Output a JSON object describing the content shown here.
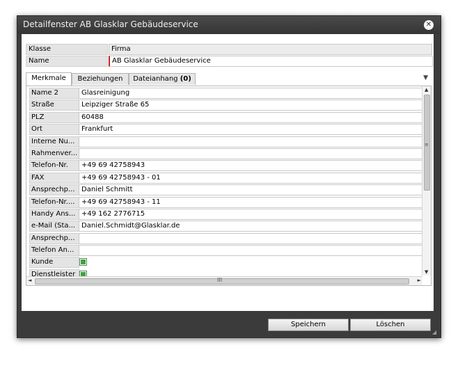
{
  "window": {
    "title": "Detailfenster AB Glasklar Gebäudeservice",
    "close_glyph": "✕"
  },
  "header": {
    "klasse_label": "Klasse",
    "klasse_value": "Firma",
    "name_label": "Name",
    "name_value": "AB Glasklar Gebäudeservice"
  },
  "tabs": [
    {
      "label": "Merkmale",
      "active": true
    },
    {
      "label": "Beziehungen",
      "active": false
    },
    {
      "label": "Dateianhang",
      "count": "(0)",
      "active": false
    }
  ],
  "tab_menu_glyph": "▼",
  "rows": [
    {
      "label": "Name 2",
      "value": "Glasreinigung"
    },
    {
      "label": "Straße",
      "value": "Leipziger Straße 65"
    },
    {
      "label": "PLZ",
      "value": "60488"
    },
    {
      "label": "Ort",
      "value": "Frankfurt"
    },
    {
      "label": "Interne Nu...",
      "value": ""
    },
    {
      "label": "Rahmenver...",
      "value": ""
    },
    {
      "label": "Telefon-Nr.",
      "value": "+49 69 42758943"
    },
    {
      "label": "FAX",
      "value": "+49 69 42758943 - 01"
    },
    {
      "label": "Ansprechp...",
      "value": "Daniel Schmitt"
    },
    {
      "label": "Telefon-Nr....",
      "value": "+49 69 42758943 - 11"
    },
    {
      "label": "Handy Ans...",
      "value": "+49 162 2776715"
    },
    {
      "label": "e-Mail (Sta...",
      "value": "Daniel.Schmidt@Glasklar.de"
    },
    {
      "label": "Ansprechp...",
      "value": ""
    },
    {
      "label": "Telefon An...",
      "value": ""
    },
    {
      "label": "Kunde",
      "checkbox": true,
      "checked": true
    },
    {
      "label": "Dienstleister",
      "checkbox": true,
      "checked": true
    }
  ],
  "scroll": {
    "up": "▲",
    "down": "▼",
    "left": "◄",
    "right": "►",
    "v_grip": "≡",
    "h_grip": "III"
  },
  "buttons": {
    "save": "Speichern",
    "delete": "Löschen"
  },
  "colors": {
    "title_bar": "#3b3b3b",
    "required_marker": "#cc2222",
    "checkbox_fill": "#3fa13f"
  }
}
